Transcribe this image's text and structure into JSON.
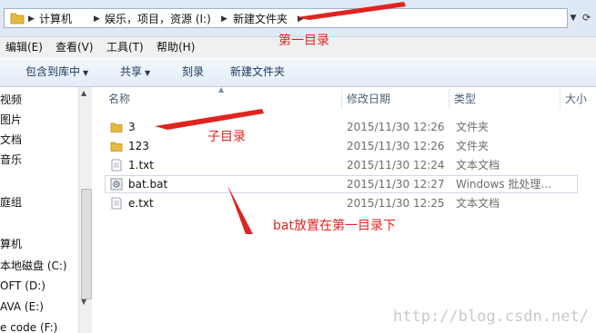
{
  "address": {
    "crumbs": [
      "计算机",
      "娱乐，项目，资源 (I:)",
      "新建文件夹"
    ]
  },
  "menu": [
    "编辑(E)",
    "查看(V)",
    "工具(T)",
    "帮助(H)"
  ],
  "toolbar": {
    "include": "包含到库中",
    "share": "共享",
    "burn": "刻录",
    "new_folder": "新建文件夹"
  },
  "nav": {
    "items": [
      "视频",
      "图片",
      "文档",
      "音乐",
      "庭组",
      "算机",
      "本地磁盘 (C:)",
      "OFT (D:)",
      "AVA (E:)",
      "e code (F:)"
    ]
  },
  "columns": {
    "name": "名称",
    "date": "修改日期",
    "type": "类型",
    "size": "大小"
  },
  "files": [
    {
      "name": "3",
      "date": "2015/11/30 12:26",
      "type": "文件夹",
      "icon": "folder-icon"
    },
    {
      "name": "123",
      "date": "2015/11/30 12:26",
      "type": "文件夹",
      "icon": "folder-icon"
    },
    {
      "name": "1.txt",
      "date": "2015/11/30 12:24",
      "type": "文本文档",
      "icon": "text-file-icon"
    },
    {
      "name": "bat.bat",
      "date": "2015/11/30 12:27",
      "type": "Windows 批处理...",
      "icon": "batch-file-icon"
    },
    {
      "name": "e.txt",
      "date": "2015/11/30 12:25",
      "type": "文本文档",
      "icon": "text-file-icon"
    }
  ],
  "annotations": {
    "first_dir": "第一目录",
    "sub_dir": "子目录",
    "bat_note": "bat放置在第一目录下"
  },
  "watermark": "http://blog.csdn.net/",
  "colors": {
    "annotation": "#e0241f",
    "folder": "#e8b93c"
  }
}
